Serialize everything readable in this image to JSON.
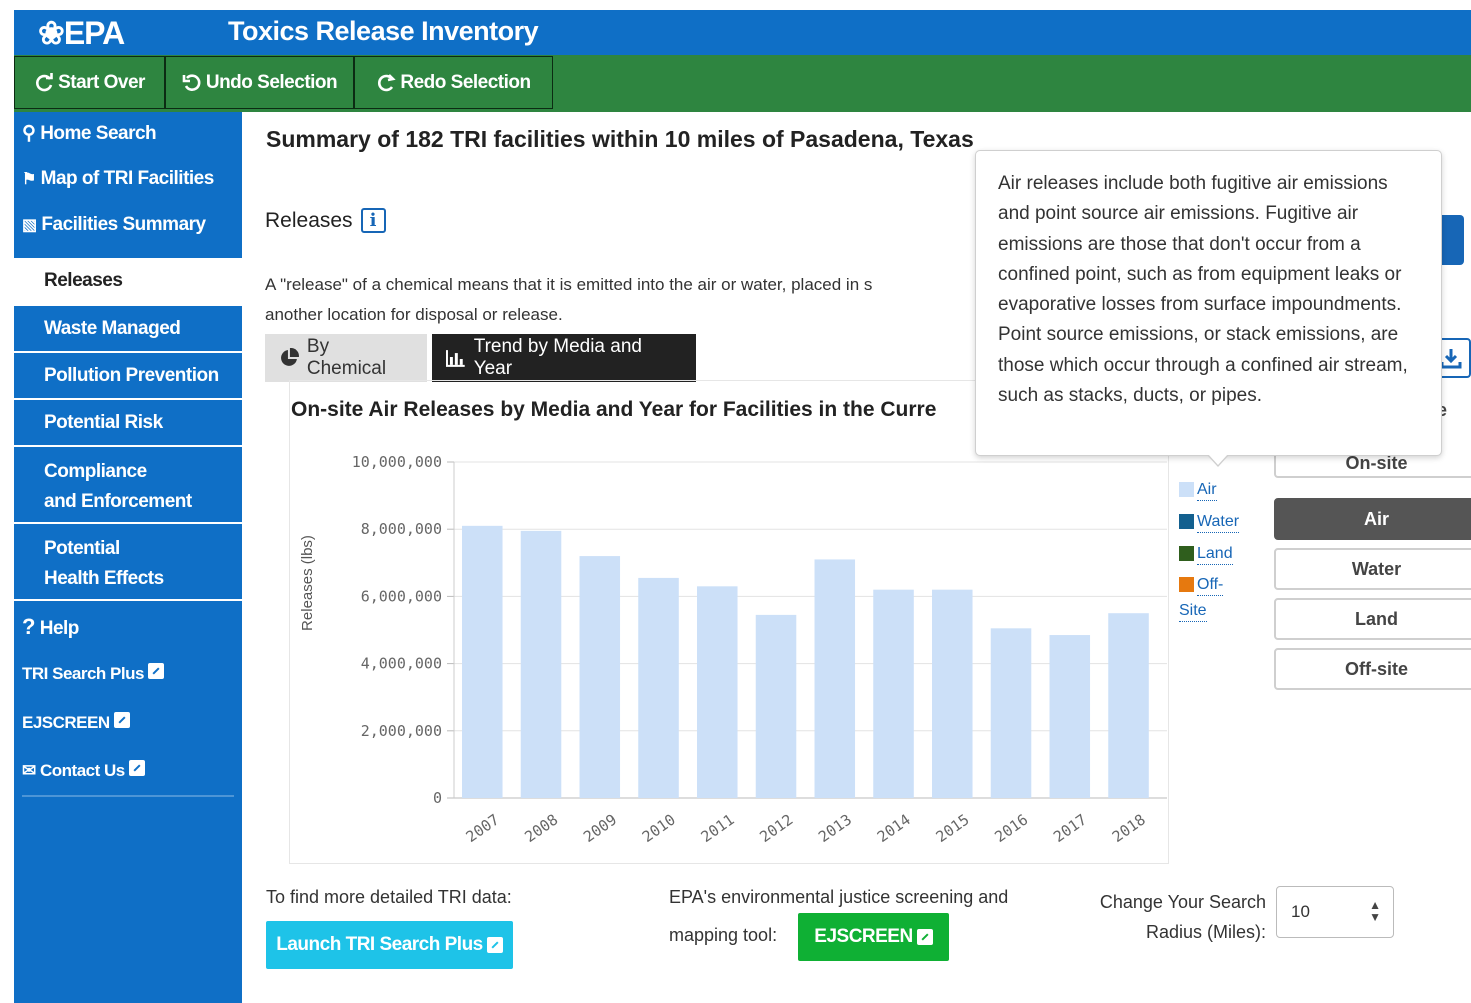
{
  "header": {
    "logo": "❀EPA",
    "app_title": "Toxics Release Inventory"
  },
  "toolbar": {
    "start_over": "Start Over",
    "undo": "Undo Selection",
    "redo": "Redo Selection"
  },
  "sidebar": {
    "home_search": "Home Search",
    "map": "Map of TRI Facilities",
    "facilities_summary": "Facilities Summary",
    "items": [
      "Releases",
      "Waste Managed",
      "Pollution Prevention",
      "Potential Risk"
    ],
    "compliance_1": "Compliance",
    "compliance_2": "and Enforcement",
    "health_1": "Potential",
    "health_2": "Health Effects",
    "help": "Help",
    "tri_search_plus": "TRI Search Plus",
    "ejscreen": "EJSCREEN",
    "contact": "Contact Us"
  },
  "main": {
    "page_title": "Summary of 182 TRI facilities within 10 miles of Pasadena, Texas",
    "section_title": "Releases",
    "info_icon": "i",
    "description_1": "A \"release\" of a chemical means that it is emitted into the air or water, placed in s",
    "description_2": "another location for disposal or release.",
    "tab_by_chemical": "By Chemical",
    "tab_trend": "Trend by Media and Year",
    "chart_title": "On-site Air Releases by Media and Year for Facilities in the Curre",
    "right_clip": "e"
  },
  "tooltip": {
    "text": "Air releases include both fugitive air emissions and point source air emissions. Fugitive air emissions are those that don't occur from a confined point, such as from equipment leaks or evaporative losses from surface impoundments. Point source emissions, or stack emissions, are those which occur through a confined air stream, such as stacks, ducts, or pipes."
  },
  "media_buttons": {
    "onsite": "On-site",
    "air": "Air",
    "water": "Water",
    "land": "Land",
    "offsite": "Off-site"
  },
  "legend": {
    "air": "Air",
    "water": "Water",
    "land": "Land",
    "offsite_1": "Off-",
    "offsite_2": "Site"
  },
  "colors": {
    "air": "#cce0f8",
    "water": "#13608f",
    "land": "#2f5e1d",
    "offsite": "#e6790f",
    "epa_blue": "#0f6fc6",
    "epa_green": "#2e8540"
  },
  "chart_data": {
    "type": "bar",
    "title": "On-site Air Releases by Media and Year for Facilities in the Curre",
    "ylabel": "Releases (lbs)",
    "categories": [
      "2007",
      "2008",
      "2009",
      "2010",
      "2011",
      "2012",
      "2013",
      "2014",
      "2015",
      "2016",
      "2017",
      "2018"
    ],
    "series": [
      {
        "name": "Air",
        "values": [
          8100000,
          7950000,
          7200000,
          6550000,
          6300000,
          5450000,
          7100000,
          6200000,
          6200000,
          5050000,
          4850000,
          5500000
        ]
      }
    ],
    "yticks": [
      "0",
      "2,000,000",
      "4,000,000",
      "6,000,000",
      "8,000,000",
      "10,000,000"
    ],
    "ylim": [
      0,
      10000000
    ],
    "grid": true
  },
  "bottom": {
    "find_more": "To find more detailed TRI data:",
    "launch": "Launch TRI Search Plus",
    "ej_text_1": "EPA's environmental justice screening and",
    "ej_text_2": "mapping tool:",
    "ej_button": "EJSCREEN",
    "radius_label_1": "Change Your Search",
    "radius_label_2": "Radius (Miles):",
    "radius_value": "10"
  }
}
